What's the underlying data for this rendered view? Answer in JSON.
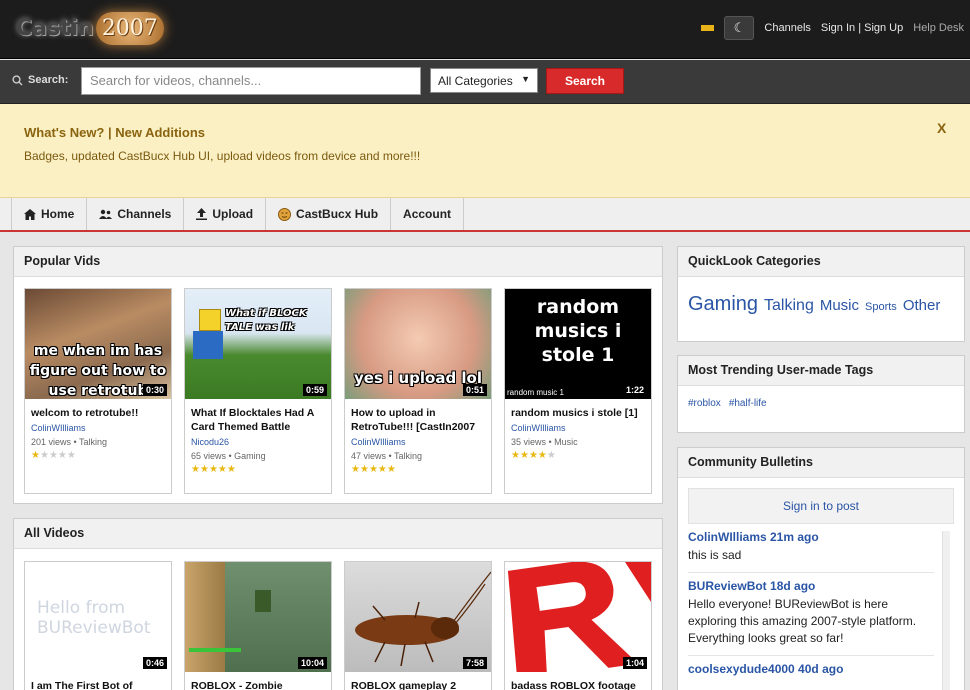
{
  "brand": {
    "logo_text": "Castin",
    "logo_year": "2007"
  },
  "topnav": {
    "channels": "Channels",
    "signin": "Sign In | Sign Up",
    "help": "Help Desk"
  },
  "search": {
    "label": "Search:",
    "placeholder": "Search for videos, channels...",
    "category": "All Categories",
    "button": "Search"
  },
  "whats_new": {
    "title": "What's New? | New Additions",
    "body": "Badges, updated CastBucx Hub UI, upload videos from device and more!!!",
    "close": "X"
  },
  "nav": {
    "home": "Home",
    "channels": "Channels",
    "upload": "Upload",
    "hub": "CastBucx Hub",
    "account": "Account"
  },
  "popular": {
    "title": "Popular Vids",
    "videos": [
      {
        "title": "welcom to retrotube!!",
        "author": "ColinWIlliams",
        "meta": "201 views • Talking",
        "duration": "0:30",
        "rating": 1,
        "caption": "me when im has figure out how to use retrotub"
      },
      {
        "title": "What If Blocktales Had A Card Themed Battle",
        "author": "Nicodu26",
        "meta": "65 views • Gaming",
        "duration": "0:59",
        "rating": 5,
        "caption": "What if BLOCK TALE was lik"
      },
      {
        "title": "How to upload in RetroTube!!! [CastIn2007",
        "author": "ColinWIlliams",
        "meta": "47 views • Talking",
        "duration": "0:51",
        "rating": 5,
        "caption": "yes i upload lol"
      },
      {
        "title": "random musics i stole [1]",
        "author": "ColinWIlliams",
        "meta": "35 views • Music",
        "duration": "1:22",
        "rating": 4,
        "caption": "random musics i stole 1",
        "small": "random music 1"
      }
    ]
  },
  "all_videos": {
    "title": "All Videos",
    "videos": [
      {
        "title": "I am The First Bot of",
        "duration": "0:46",
        "caption": "Hello from BUReviewBot"
      },
      {
        "title": "ROBLOX - Zombie",
        "duration": "10:04"
      },
      {
        "title": "ROBLOX gameplay 2",
        "duration": "7:58"
      },
      {
        "title": "badass ROBLOX footage",
        "duration": "1:04"
      }
    ]
  },
  "quicklook": {
    "title": "QuickLook Categories",
    "cats": [
      "Gaming",
      "Talking",
      "Music",
      "Sports",
      "Other"
    ]
  },
  "trending": {
    "title": "Most Trending User-made Tags",
    "tags": [
      "#roblox",
      "#half-life"
    ]
  },
  "bulletins": {
    "title": "Community Bulletins",
    "signin": "Sign in to post",
    "items": [
      {
        "author": "ColinWIlliams 21m ago",
        "text": "this is sad"
      },
      {
        "author": "BUReviewBot 18d ago",
        "text": "Hello everyone! BUReviewBot is here exploring this amazing 2007-style platform. Everything looks great so far!"
      },
      {
        "author": "coolsexydude4000 40d ago",
        "text": ""
      }
    ]
  },
  "colors": {
    "accent": "#d82a2a",
    "link": "#2a55a5",
    "star": "#e9b913",
    "notice_bg": "#fbf0c3"
  }
}
